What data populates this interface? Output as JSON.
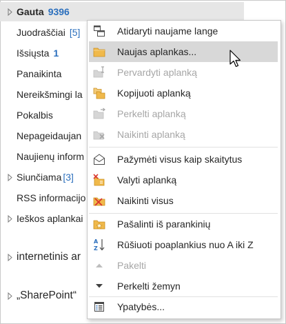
{
  "folders": [
    {
      "label": "Gauta",
      "count": "9396",
      "selected": true,
      "bold": true,
      "chevron": true
    },
    {
      "label": "Juodraščiai",
      "count": "[5]"
    },
    {
      "label": "Išsiųsta",
      "count_bold": "1"
    },
    {
      "label": "Panaikinta"
    },
    {
      "label": "Nereikšmingi la"
    },
    {
      "label": "Pokalbis"
    },
    {
      "label": "Nepageidaujan"
    },
    {
      "label": "Naujienų inform"
    },
    {
      "label": "Siunčiama",
      "count": "[3]",
      "chevron": true
    },
    {
      "label": "RSS informacijo"
    },
    {
      "label": "Ieškos aplankai",
      "chevron": true
    },
    {
      "label": "internetinis ar",
      "chevron": true
    },
    {
      "label": "„SharePoint“",
      "chevron": true
    }
  ],
  "menu": [
    {
      "label": "Atidaryti naujame lange",
      "icon": "new-window-icon",
      "disabled": false
    },
    {
      "label": "Naujas aplankas...",
      "icon": "new-folder-icon",
      "disabled": false,
      "highlight": true
    },
    {
      "label": "Pervardyti aplanką",
      "icon": "rename-folder-icon",
      "disabled": true
    },
    {
      "label": "Kopijuoti aplanką",
      "icon": "copy-folder-icon",
      "disabled": false
    },
    {
      "label": "Perkelti aplanką",
      "icon": "move-folder-icon",
      "disabled": true
    },
    {
      "label": "Naikinti aplanką",
      "icon": "delete-folder-icon",
      "disabled": true
    },
    {
      "label": "Pažymėti visus kaip skaitytus",
      "icon": "mark-all-read-icon",
      "disabled": false
    },
    {
      "label": "Valyti aplanką",
      "icon": "clean-up-folder-icon",
      "disabled": false
    },
    {
      "label": "Naikinti visus",
      "icon": "delete-all-icon",
      "disabled": false
    },
    {
      "label": "Pašalinti iš parankinių",
      "icon": "remove-from-favorites-icon",
      "disabled": false
    },
    {
      "label": "Rūšiuoti poaplankius nuo A iki Z",
      "icon": "sort-a-z-icon",
      "disabled": false
    },
    {
      "label": "Pakelti",
      "icon": "move-up-icon",
      "disabled": true
    },
    {
      "label": "Perkelti žemyn",
      "icon": "move-down-icon",
      "disabled": false
    },
    {
      "label": "Ypatybės...",
      "icon": "properties-icon",
      "disabled": false
    }
  ],
  "colors": {
    "accent_blue": "#2b6fbd",
    "folder_yellow": "#f0b94b",
    "delete_red": "#d9342b",
    "selection_gray": "#e6e6e6",
    "menu_highlight": "#d8d8d8"
  }
}
